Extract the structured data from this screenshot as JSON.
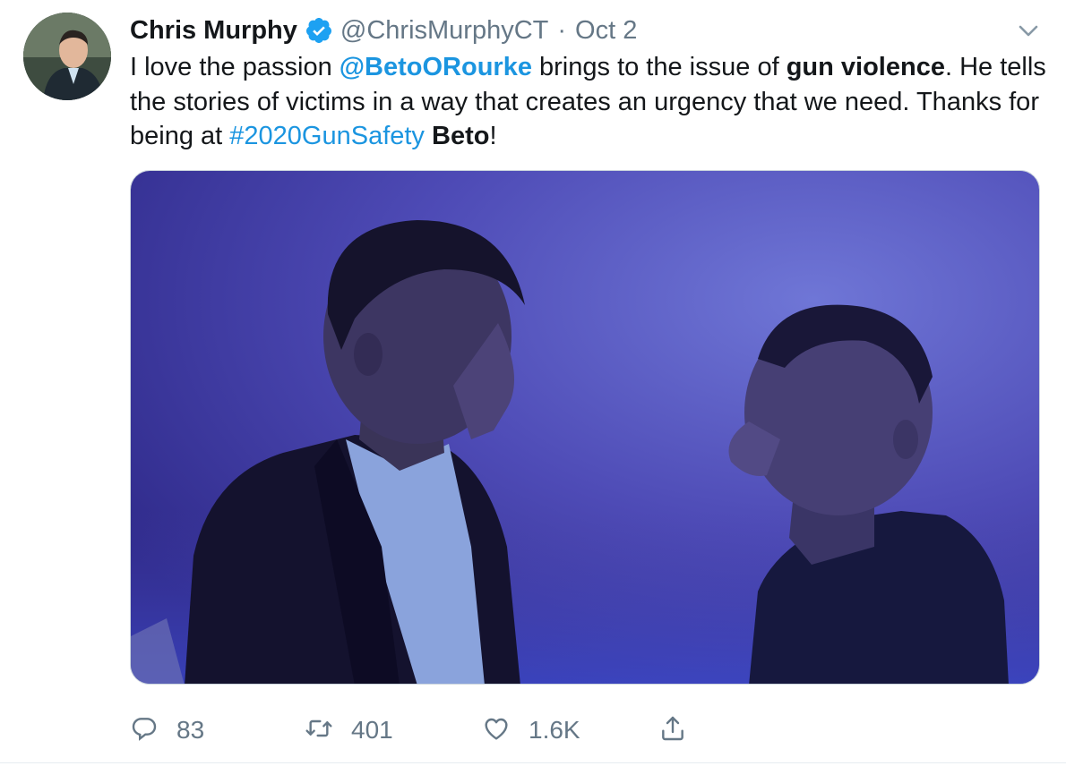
{
  "tweet": {
    "author_name": "Chris Murphy",
    "author_handle": "@ChrisMurphyCT",
    "separator": "·",
    "date": "Oct 2",
    "verified": true,
    "text": {
      "t1": "I love the passion ",
      "mention": "@BetoORourke",
      "t2": " brings to the issue of ",
      "bold1": "gun violence",
      "t3": ". He tells the stories of victims in a way that creates an urgency that we need. Thanks for being at ",
      "hashtag": "#2020GunSafety",
      "t4": " ",
      "bold2": "Beto",
      "t5": "!"
    }
  },
  "actions": {
    "reply_count": "83",
    "retweet_count": "401",
    "like_count": "1.6K"
  },
  "colors": {
    "link": "#1b95e0",
    "secondary_text": "#657786",
    "verified_badge": "#1da1f2",
    "photo_background": "#4b45a8"
  },
  "icons": {
    "verified": "verified-badge-icon",
    "caret": "chevron-down-icon",
    "reply": "reply-bubble-icon",
    "retweet": "retweet-icon",
    "like": "heart-icon",
    "share": "share-upload-icon"
  }
}
